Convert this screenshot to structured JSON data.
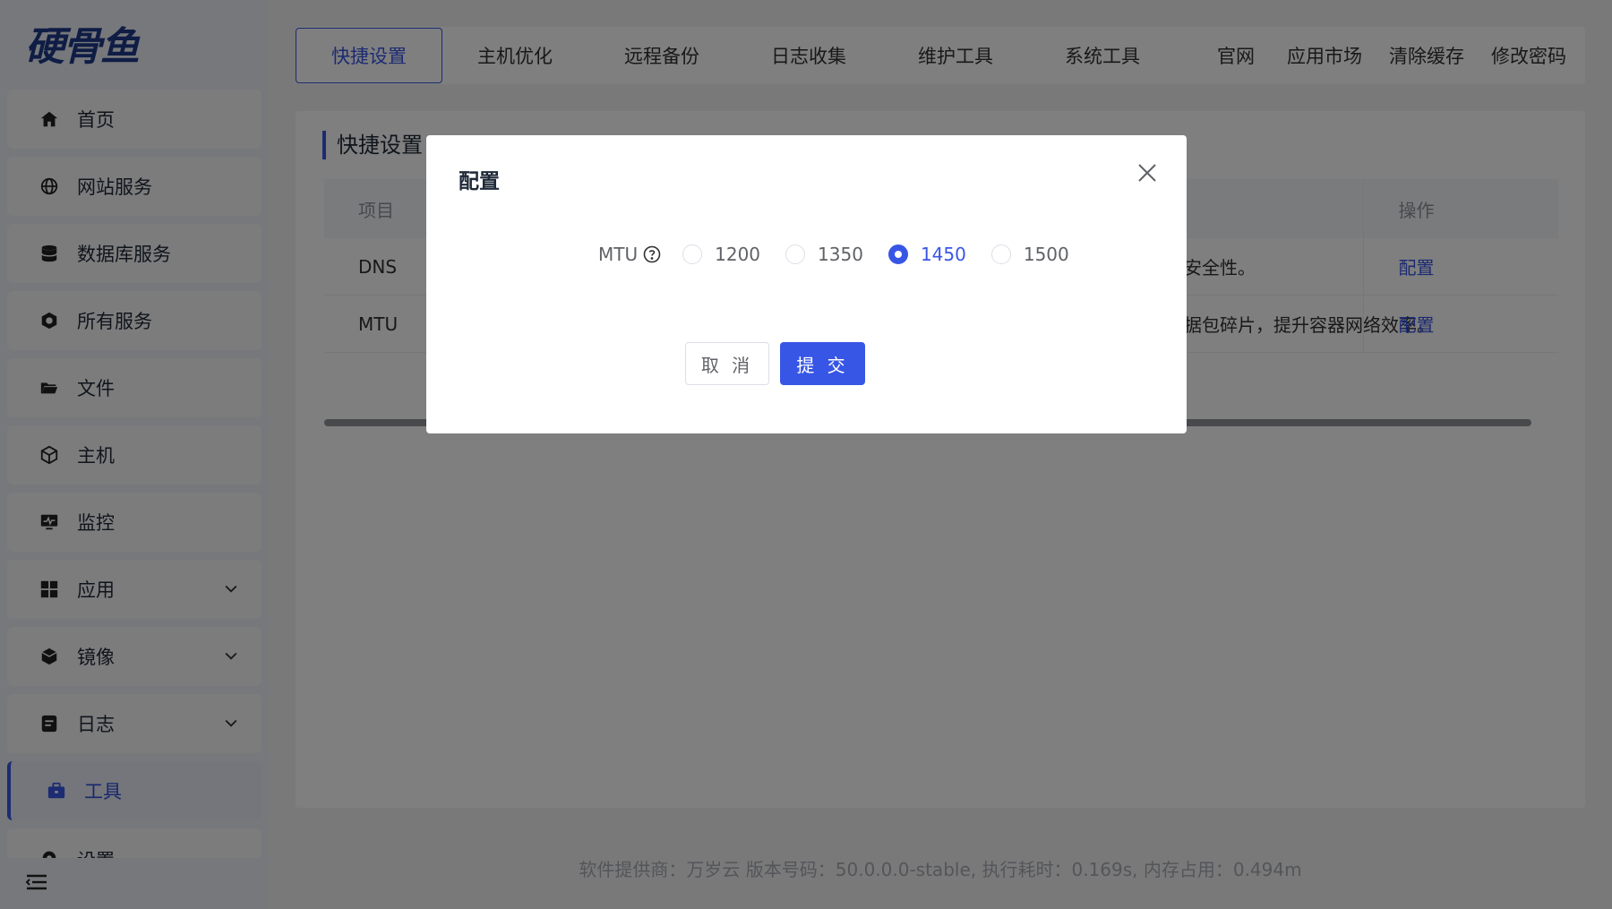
{
  "logo": {
    "text": "硬骨鱼"
  },
  "sidebar": {
    "items": [
      {
        "label": "首页",
        "icon": "home-icon"
      },
      {
        "label": "网站服务",
        "icon": "globe-icon"
      },
      {
        "label": "数据库服务",
        "icon": "database-icon"
      },
      {
        "label": "所有服务",
        "icon": "services-icon"
      },
      {
        "label": "文件",
        "icon": "folder-icon"
      },
      {
        "label": "主机",
        "icon": "host-icon"
      },
      {
        "label": "监控",
        "icon": "monitor-icon"
      },
      {
        "label": "应用",
        "icon": "grid-icon"
      },
      {
        "label": "镜像",
        "icon": "box-icon"
      },
      {
        "label": "日志",
        "icon": "log-icon"
      },
      {
        "label": "工具",
        "icon": "toolbox-icon"
      },
      {
        "label": "设置",
        "icon": "gear-icon"
      }
    ],
    "active": "工具"
  },
  "tabs": {
    "quick": "快捷设置",
    "optimize": "主机优化",
    "backup": "远程备份",
    "logs": "日志收集",
    "maintenance": "维护工具",
    "system": "系统工具",
    "site": "官网",
    "market": "应用市场",
    "cache": "清除缓存",
    "password": "修改密码"
  },
  "panel": {
    "title": "快捷设置",
    "columns": {
      "item": "项目",
      "op": "操作"
    },
    "rows": [
      {
        "item": "DNS",
        "desc": "安全性。",
        "op": "配置"
      },
      {
        "item": "MTU",
        "desc": "据包碎片，提升容器网络效率。",
        "op": "配置"
      }
    ]
  },
  "footer": "软件提供商：万岁云    版本号码：50.0.0.0-stable, 执行耗时：0.169s, 内存占用：0.494m",
  "modal": {
    "title": "配置",
    "field_label": "MTU",
    "options": [
      "1200",
      "1350",
      "1450",
      "1500"
    ],
    "selected": "1450",
    "cancel": "取 消",
    "submit": "提 交"
  },
  "colors": {
    "accent": "#3856e5"
  }
}
